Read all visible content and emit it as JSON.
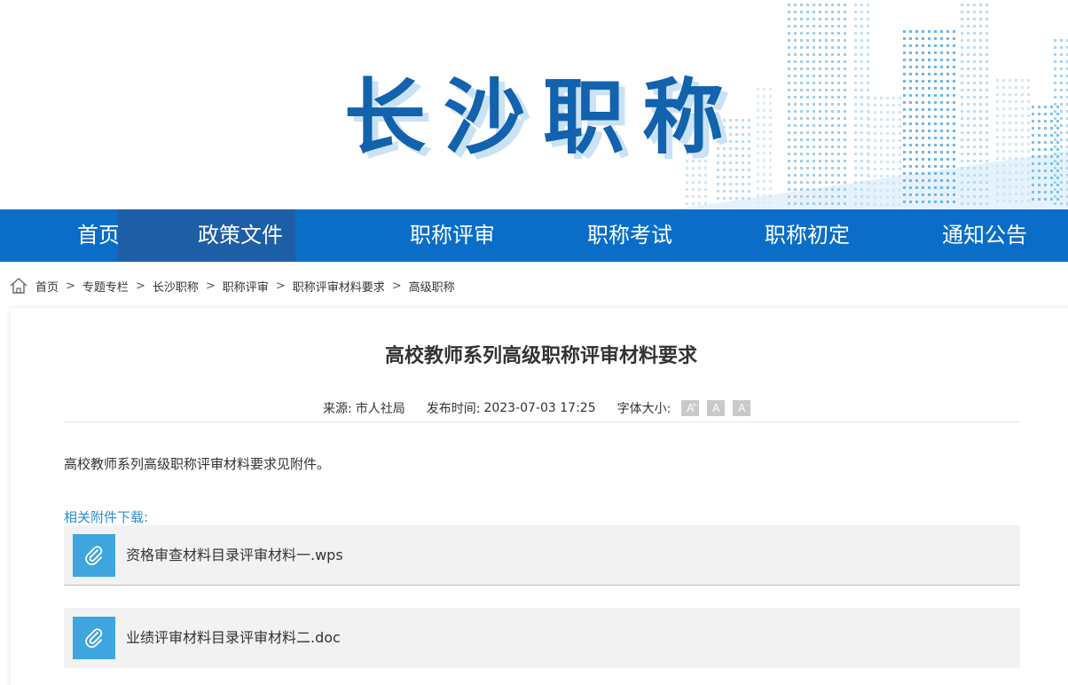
{
  "banner": {
    "title": "长沙职称"
  },
  "nav": {
    "items": [
      {
        "label": "首页"
      },
      {
        "label": "政策文件"
      },
      {
        "label": "职称评审"
      },
      {
        "label": "职称考试"
      },
      {
        "label": "职称初定"
      },
      {
        "label": "通知公告"
      }
    ]
  },
  "breadcrumb": {
    "icon": "home-icon",
    "items": [
      "首页",
      "专题专栏",
      "长沙职称",
      "职称评审",
      "职称评审材料要求",
      "高级职称"
    ],
    "separator": ">"
  },
  "article": {
    "title": "高校教师系列高级职称评审材料要求",
    "source_label": "来源:",
    "source": "市人社局",
    "date_label": "发布时间:",
    "date": "2023-07-03 17:25",
    "font_size_label": "字体大小:",
    "font_buttons": [
      "A",
      "A",
      "A"
    ],
    "font_button_marks": [
      "+",
      "",
      "-"
    ],
    "body": "高校教师系列高级职称评审材料要求见附件。",
    "attachments_label": "相关附件下载:",
    "attachments": [
      {
        "name": "资格审查材料目录评审材料一.wps",
        "icon": "paperclip-icon"
      },
      {
        "name": "业绩评审材料目录评审材料二.doc",
        "icon": "paperclip-icon"
      }
    ]
  },
  "colors": {
    "nav_bg": "#0a6ec9",
    "nav_active": "#1d5ea6",
    "title_blue": "#1262ae",
    "attach_icon_bg": "#3fa5de",
    "attach_label": "#2a8fd1"
  }
}
